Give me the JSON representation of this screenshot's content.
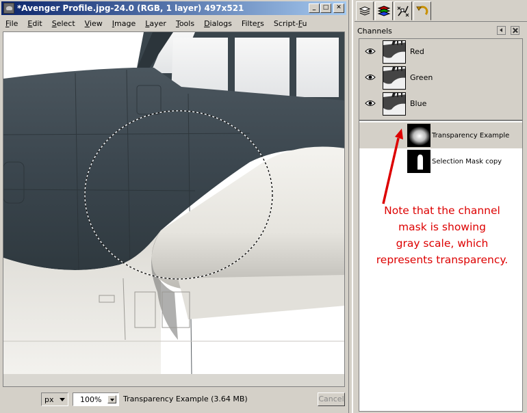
{
  "window": {
    "title": "*Avenger Profile.jpg-24.0 (RGB, 1 layer) 497x521",
    "controls": [
      "_",
      "□",
      "✕"
    ]
  },
  "menu": [
    {
      "pre": "",
      "u": "F",
      "post": "ile"
    },
    {
      "pre": "",
      "u": "E",
      "post": "dit"
    },
    {
      "pre": "",
      "u": "S",
      "post": "elect"
    },
    {
      "pre": "",
      "u": "V",
      "post": "iew"
    },
    {
      "pre": "",
      "u": "I",
      "post": "mage"
    },
    {
      "pre": "",
      "u": "L",
      "post": "ayer"
    },
    {
      "pre": "",
      "u": "T",
      "post": "ools"
    },
    {
      "pre": "",
      "u": "D",
      "post": "ialogs"
    },
    {
      "pre": "Filte",
      "u": "r",
      "post": "s"
    },
    {
      "pre": "Script-",
      "u": "F",
      "post": "u"
    }
  ],
  "status": {
    "unit": "px",
    "zoom": "100%",
    "message": "Transparency Example (3.64 MB)",
    "cancel_label": "Cancel"
  },
  "dock": {
    "tabs": [
      "layers-icon",
      "channels-icon",
      "paths-icon",
      "undo-history-icon"
    ],
    "active_tab": 1,
    "panel_title": "Channels",
    "channels": [
      {
        "label": "Red",
        "visible": true
      },
      {
        "label": "Green",
        "visible": true
      },
      {
        "label": "Blue",
        "visible": true
      }
    ],
    "masks": [
      {
        "label": "Transparency Example",
        "selected": true
      },
      {
        "label": "Selection Mask copy",
        "selected": false
      }
    ]
  },
  "annotation": {
    "lines": [
      "Note that the channel",
      "mask is showing",
      "gray scale, which",
      "represents transparency."
    ],
    "color": "#dd0000"
  },
  "colors": {
    "titlebar_start": "#0a246a",
    "titlebar_end": "#a6caf0",
    "fuselage_dark": "#3e4a52",
    "fuselage_light": "#e8e6e0"
  }
}
